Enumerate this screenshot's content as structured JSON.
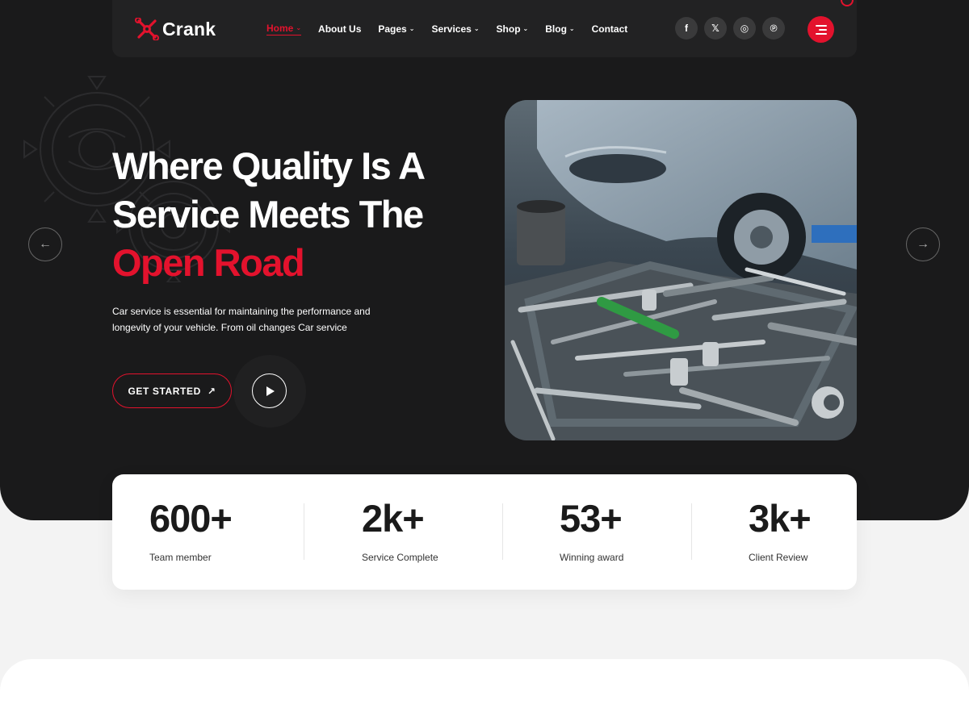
{
  "brand": {
    "name": "Crank",
    "accent": "#e3122d",
    "dark": "#1a1a1b"
  },
  "nav": {
    "items": [
      {
        "label": "Home",
        "caret": true,
        "active": true
      },
      {
        "label": "About Us",
        "caret": false
      },
      {
        "label": "Pages",
        "caret": true
      },
      {
        "label": "Services",
        "caret": true
      },
      {
        "label": "Shop",
        "caret": true
      },
      {
        "label": "Blog",
        "caret": true
      },
      {
        "label": "Contact",
        "caret": false
      }
    ],
    "socials": [
      {
        "icon": "facebook-icon",
        "glyph": "f"
      },
      {
        "icon": "x-icon",
        "glyph": "𝕏"
      },
      {
        "icon": "instagram-icon",
        "glyph": "◎"
      },
      {
        "icon": "pinterest-icon",
        "glyph": "℗"
      }
    ],
    "caret_glyph": "⌄"
  },
  "hero": {
    "line1": "Where Quality Is A",
    "line2": "Service Meets The",
    "line3": "Open Road",
    "subtext": "Car service is essential for maintaining the performance and longevity of your vehicle. From oil changes Car service",
    "cta_label": "GET STARTED",
    "cta_arrow": "↗",
    "prev_arrow": "←",
    "next_arrow": "→"
  },
  "stats": [
    {
      "value": "600+",
      "label": "Team member"
    },
    {
      "value": "2k+",
      "label": "Service Complete"
    },
    {
      "value": "53+",
      "label": "Winning award"
    },
    {
      "value": "3k+",
      "label": "Client Review"
    }
  ]
}
